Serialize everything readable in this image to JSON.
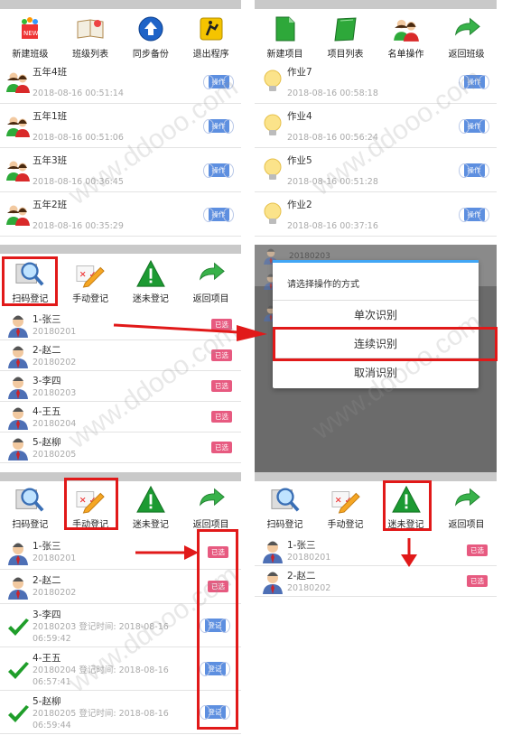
{
  "panel1": {
    "toolbar": [
      "新建班级",
      "班级列表",
      "同步备份",
      "退出程序"
    ],
    "rows": [
      {
        "name": "五年4班",
        "time": "2018-08-16 00:51:14",
        "btn": "操作"
      },
      {
        "name": "五年1班",
        "time": "2018-08-16 00:51:06",
        "btn": "操作"
      },
      {
        "name": "五年3班",
        "time": "2018-08-16 00:36:45",
        "btn": "操作"
      },
      {
        "name": "五年2班",
        "time": "2018-08-16 00:35:29",
        "btn": "操作"
      }
    ]
  },
  "panel2": {
    "toolbar": [
      "新建项目",
      "项目列表",
      "名单操作",
      "返回班级"
    ],
    "rows": [
      {
        "name": "作业7",
        "time": "2018-08-16 00:58:18",
        "btn": "操作"
      },
      {
        "name": "作业4",
        "time": "2018-08-16 00:56:24",
        "btn": "操作"
      },
      {
        "name": "作业5",
        "time": "2018-08-16 00:51:28",
        "btn": "操作"
      },
      {
        "name": "作业2",
        "time": "2018-08-16 00:37:16",
        "btn": "操作"
      }
    ]
  },
  "panel3": {
    "toolbar": [
      "扫码登记",
      "手动登记",
      "迷未登记",
      "返回项目"
    ],
    "rows": [
      {
        "name": "1-张三",
        "id": "20180201",
        "btn": "已选"
      },
      {
        "name": "2-赵二",
        "id": "20180202",
        "btn": "已选"
      },
      {
        "name": "3-李四",
        "id": "20180203",
        "btn": "已选"
      },
      {
        "name": "4-王五",
        "id": "20180204",
        "btn": "已选"
      },
      {
        "name": "5-赵柳",
        "id": "20180205",
        "btn": "已选"
      }
    ]
  },
  "panel4": {
    "bg_text": "20180203",
    "dialog": {
      "title": "请选择操作的方式",
      "options": [
        "单次识别",
        "连续识别",
        "取消识别"
      ]
    }
  },
  "panel5": {
    "toolbar": [
      "扫码登记",
      "手动登记",
      "迷未登记",
      "返回项目"
    ],
    "rows": [
      {
        "name": "1-张三",
        "line1": "20180201",
        "line2": "",
        "btn": "已选",
        "checked": false
      },
      {
        "name": "2-赵二",
        "line1": "20180202",
        "line2": "",
        "btn": "已选",
        "checked": false
      },
      {
        "name": "3-李四",
        "line1": "20180203 登记时间: 2018-08-16",
        "line2": "06:59:42",
        "btn": "登记",
        "checked": true
      },
      {
        "name": "4-王五",
        "line1": "20180204 登记时间: 2018-08-16",
        "line2": "06:57:41",
        "btn": "登记",
        "checked": true
      },
      {
        "name": "5-赵柳",
        "line1": "20180205 登记时间: 2018-08-16",
        "line2": "06:59:44",
        "btn": "登记",
        "checked": true
      }
    ]
  },
  "panel6": {
    "toolbar": [
      "扫码登记",
      "手动登记",
      "迷未登记",
      "返回项目"
    ],
    "rows": [
      {
        "name": "1-张三",
        "id": "20180201",
        "btn": "已选"
      },
      {
        "name": "2-赵二",
        "id": "20180202",
        "btn": "已选"
      }
    ]
  },
  "watermark": "www.ddooo.com",
  "colors": {
    "highlight": "#e11919",
    "blue_btn": "#5d8fe0",
    "pink_btn": "#e75a80",
    "dialog_bg": "#6b6b6b"
  }
}
